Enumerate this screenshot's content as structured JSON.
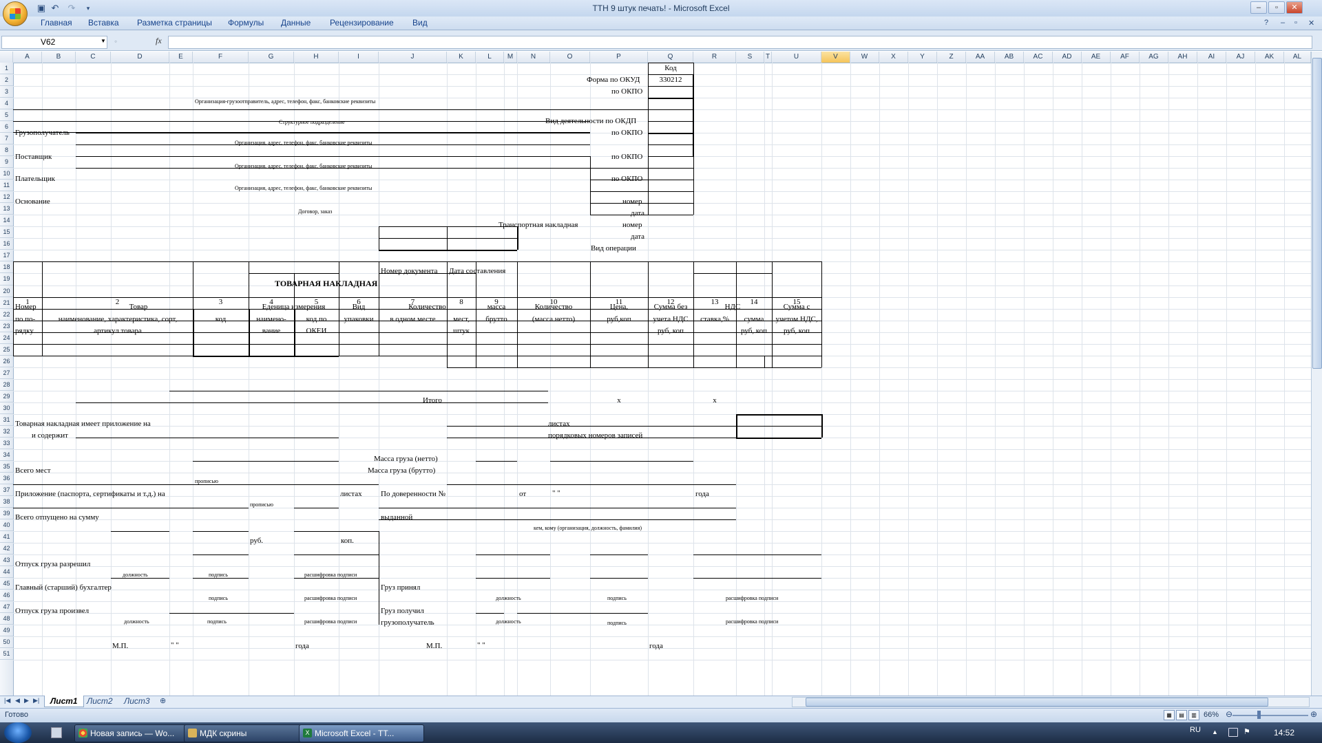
{
  "window": {
    "title": "ТТН  9 штук печать! - Microsoft Excel",
    "controls": [
      "–",
      "▫",
      "✕"
    ]
  },
  "ribbon": {
    "tabs": [
      "Главная",
      "Вставка",
      "Разметка страницы",
      "Формулы",
      "Данные",
      "Рецензирование",
      "Вид"
    ]
  },
  "formula_bar": {
    "name_box": "V62",
    "fx": "fx",
    "value": ""
  },
  "columns": [
    "A",
    "B",
    "C",
    "D",
    "E",
    "F",
    "G",
    "H",
    "I",
    "J",
    "K",
    "L",
    "M",
    "N",
    "O",
    "P",
    "Q",
    "R",
    "S",
    "T",
    "U",
    "V",
    "W",
    "X",
    "Y",
    "Z",
    "AA",
    "AB",
    "AC",
    "AD",
    "AE",
    "AF",
    "AG",
    "AH",
    "AI",
    "AJ",
    "AK",
    "AL"
  ],
  "selected_column": "V",
  "rows": [
    "1",
    "2",
    "3",
    "4",
    "5",
    "6",
    "7",
    "8",
    "9",
    "10",
    "11",
    "12",
    "13",
    "14",
    "15",
    "16",
    "17",
    "18",
    "19",
    "20",
    "21",
    "22",
    "23",
    "24",
    "25",
    "26",
    "27",
    "28",
    "29",
    "30",
    "31",
    "32",
    "33",
    "34",
    "35",
    "36",
    "37",
    "38",
    "39",
    "40",
    "41",
    "42",
    "43",
    "44",
    "45",
    "46",
    "47",
    "48",
    "49",
    "50",
    "51"
  ],
  "form": {
    "kod": "Код",
    "okud_label": "Форма по ОКУД",
    "okud_value": "330212",
    "okpo": "по ОКПО",
    "org_hint": "Организация-грузоотправитель, адрес, телефон, факс, банковские реквизиты",
    "struct_hint": "Структурное подразделение",
    "okdp": "Вид деятельности по ОКДП",
    "consignee": "Грузополучатель",
    "org_hint2": "Организация, адрес, телефон, факс, банковские реквизиты",
    "supplier": "Поставщик",
    "payer": "Плательщик",
    "basis": "Основание",
    "contract_hint": "Договор, заказ",
    "nomer": "номер",
    "data": "дата",
    "transport": "Транспортная накладная",
    "operation": "Вид операции",
    "doc_number": "Номер документа",
    "doc_date": "Дата составления",
    "title": "ТОВАРНАЯ НАКЛАДНАЯ"
  },
  "table": {
    "h_num": [
      "Номер",
      "по по-",
      "рядку"
    ],
    "h_goods": "Товар",
    "h_goods_sub": [
      "наименование, характеристика, сорт,",
      "артикул товара"
    ],
    "h_kod": "код",
    "h_unit": "Еденица измерения",
    "h_unit_name": [
      "наимено-",
      "вание"
    ],
    "h_unit_okei": [
      "код по",
      "ОКЕИ"
    ],
    "h_pack": [
      "Вид",
      "упаковки"
    ],
    "h_qty": "Количество",
    "h_qty_place": "в одном месте",
    "h_qty_pieces": [
      "мест,",
      "штук"
    ],
    "h_mass": [
      "масса",
      "брутто"
    ],
    "h_qty_net": [
      "Количество",
      "(масса нетто)"
    ],
    "h_price": [
      "Цена,",
      "руб,коп"
    ],
    "h_sum_novat": [
      "Сумма без",
      "учета НДС",
      "руб, коп"
    ],
    "h_vat": "НДС",
    "h_vat_rate": "ставка,%",
    "h_vat_sum": [
      "сумма",
      "руб, коп"
    ],
    "h_sum_vat": [
      "Сумма с",
      "учетом НДС,",
      "руб, коп"
    ],
    "col_numbers": [
      "1",
      "2",
      "3",
      "4",
      "5",
      "6",
      "7",
      "8",
      "9",
      "10",
      "11",
      "12",
      "13",
      "14",
      "15"
    ],
    "itogo": "Итого",
    "x": "x"
  },
  "footer": {
    "appendix": "Товарная накладная имеет приложение на",
    "sheets": "листах",
    "contains": "и содержит",
    "records": "порядковых номеров записей",
    "mass_net": "Масса груза (нетто)",
    "mass_gross": "Масса груза (брутто)",
    "total_places": "Всего мест",
    "propisyu": "прописью",
    "attachment": "Приложение (паспорта, сертификаты и т.д.) на",
    "listah": "листах",
    "proxy": "По доверенности №",
    "ot": "от",
    "quotes": "\"        \"",
    "goda": "года",
    "total_sum": "Всего отпущено на сумму",
    "issued": "выданной",
    "whom_hint": "кем, кому (организация, должность, фамилия)",
    "rub": "руб.",
    "kop": "коп.",
    "release_allowed": "Отпуск груза разрешил",
    "dolzhnost": "должность",
    "podpis": "подпись",
    "rasshifrovka": "расшифровка подписи",
    "chief_accountant": "Главный (старший) бухгалтер",
    "cargo_accepted": "Груз принял",
    "release_made": "Отпуск груза произвел",
    "cargo_received": "Груз получил",
    "consignee2": "грузополучатель",
    "mp": "М.П."
  },
  "sheet_tabs": [
    "Лист1",
    "Лист2",
    "Лист3"
  ],
  "status": {
    "text": "Готово",
    "zoom": "66%"
  },
  "taskbar": {
    "items": [
      "Новая запись — Wo...",
      "МДК скрины",
      "Microsoft Excel - ТТ..."
    ],
    "lang": "RU",
    "clock": "14:52"
  }
}
